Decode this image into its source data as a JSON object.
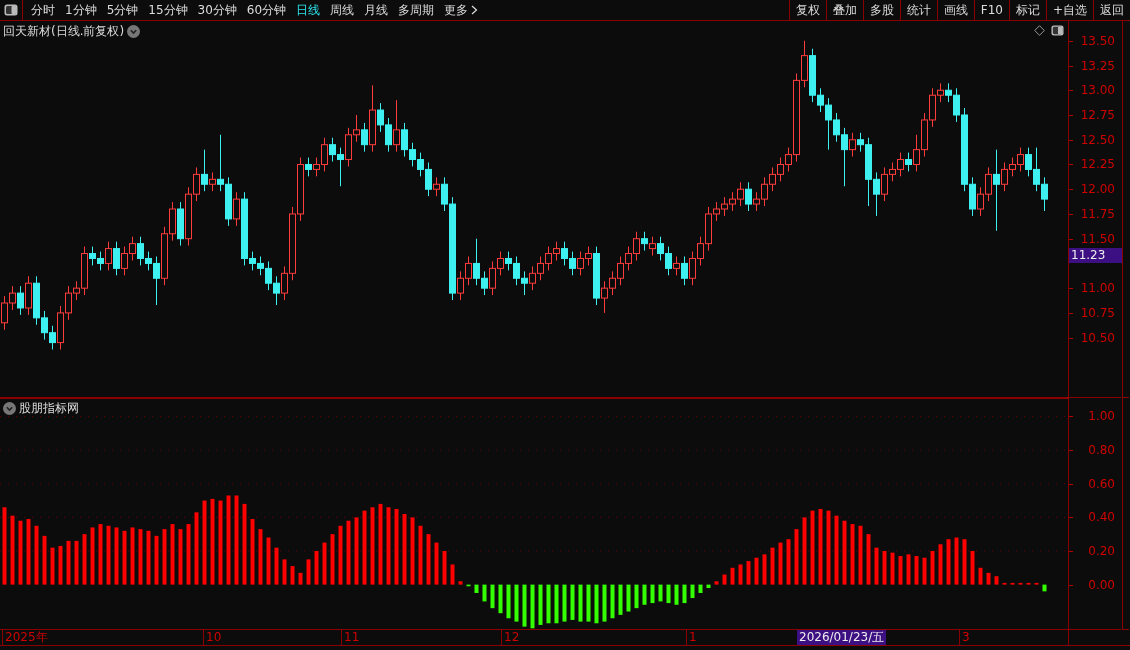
{
  "toolbar": {
    "periods": [
      {
        "label": "分时",
        "selected": false
      },
      {
        "label": "1分钟",
        "selected": false
      },
      {
        "label": "5分钟",
        "selected": false
      },
      {
        "label": "15分钟",
        "selected": false
      },
      {
        "label": "30分钟",
        "selected": false
      },
      {
        "label": "60分钟",
        "selected": false
      },
      {
        "label": "日线",
        "selected": true
      },
      {
        "label": "周线",
        "selected": false
      },
      {
        "label": "月线",
        "selected": false
      },
      {
        "label": "多周期",
        "selected": false
      }
    ],
    "more": "更多",
    "actions": [
      "复权",
      "叠加",
      "多股",
      "统计",
      "画线",
      "F10",
      "标记",
      "+自选",
      "返回"
    ]
  },
  "main_chart": {
    "title": "回天新材(日线.前复权)",
    "last_price": "11.23",
    "chart_data": {
      "type": "candlestick",
      "ylim": [
        9.89,
        13.7
      ],
      "yticks": [
        {
          "value": 13.5,
          "label": "13.50"
        },
        {
          "value": 13.25,
          "label": "13.25"
        },
        {
          "value": 13,
          "label": "13.00"
        },
        {
          "value": 12.75,
          "label": "12.75"
        },
        {
          "value": 12.5,
          "label": "12.50"
        },
        {
          "value": 12.25,
          "label": "12.25"
        },
        {
          "value": 12,
          "label": "12.00"
        },
        {
          "value": 11.75,
          "label": "11.75"
        },
        {
          "value": 11.5,
          "label": "11.50"
        },
        {
          "value": 11,
          "label": "11.00"
        },
        {
          "value": 10.75,
          "label": "10.75"
        },
        {
          "value": 10.5,
          "label": "10.50"
        }
      ],
      "ohlc": [
        [
          10.65,
          10.92,
          10.58,
          10.85
        ],
        [
          10.85,
          11.02,
          10.78,
          10.95
        ],
        [
          10.95,
          11.02,
          10.73,
          10.8
        ],
        [
          10.8,
          11.12,
          10.73,
          11.05
        ],
        [
          11.05,
          11.12,
          10.63,
          10.7
        ],
        [
          10.7,
          10.77,
          10.48,
          10.55
        ],
        [
          10.55,
          10.62,
          10.38,
          10.45
        ],
        [
          10.45,
          10.82,
          10.38,
          10.75
        ],
        [
          10.75,
          11.02,
          10.68,
          10.95
        ],
        [
          10.95,
          11.07,
          10.88,
          11.0
        ],
        [
          11.0,
          11.42,
          10.93,
          11.35
        ],
        [
          11.35,
          11.42,
          11.23,
          11.3
        ],
        [
          11.3,
          11.37,
          11.18,
          11.25
        ],
        [
          11.25,
          11.47,
          11.18,
          11.4
        ],
        [
          11.4,
          11.47,
          11.13,
          11.2
        ],
        [
          11.2,
          11.42,
          11.13,
          11.35
        ],
        [
          11.35,
          11.52,
          11.28,
          11.45
        ],
        [
          11.45,
          11.52,
          11.23,
          11.3
        ],
        [
          11.3,
          11.37,
          11.18,
          11.25
        ],
        [
          11.25,
          11.32,
          10.83,
          11.1
        ],
        [
          11.1,
          11.62,
          11.03,
          11.55
        ],
        [
          11.55,
          11.87,
          11.48,
          11.8
        ],
        [
          11.8,
          11.87,
          11.43,
          11.5
        ],
        [
          11.5,
          12.02,
          11.43,
          11.95
        ],
        [
          11.95,
          12.22,
          11.88,
          12.15
        ],
        [
          12.15,
          12.4,
          11.98,
          12.05
        ],
        [
          12.05,
          12.17,
          11.98,
          12.1
        ],
        [
          12.1,
          12.55,
          11.98,
          12.05
        ],
        [
          12.05,
          12.12,
          11.63,
          11.7
        ],
        [
          11.7,
          11.97,
          11.63,
          11.9
        ],
        [
          11.9,
          11.97,
          11.23,
          11.3
        ],
        [
          11.3,
          11.37,
          11.18,
          11.25
        ],
        [
          11.25,
          11.32,
          11.13,
          11.2
        ],
        [
          11.2,
          11.27,
          10.98,
          11.05
        ],
        [
          11.05,
          11.12,
          10.83,
          10.95
        ],
        [
          10.95,
          11.22,
          10.88,
          11.15
        ],
        [
          11.15,
          11.82,
          11.08,
          11.75
        ],
        [
          11.75,
          12.32,
          11.68,
          12.25
        ],
        [
          12.25,
          12.32,
          12.13,
          12.2
        ],
        [
          12.2,
          12.32,
          12.13,
          12.25
        ],
        [
          12.25,
          12.52,
          12.18,
          12.45
        ],
        [
          12.45,
          12.52,
          12.28,
          12.35
        ],
        [
          12.35,
          12.42,
          12.03,
          12.3
        ],
        [
          12.3,
          12.62,
          12.23,
          12.55
        ],
        [
          12.55,
          12.75,
          12.48,
          12.6
        ],
        [
          12.6,
          12.67,
          12.38,
          12.45
        ],
        [
          12.45,
          13.05,
          12.38,
          12.8
        ],
        [
          12.8,
          12.87,
          12.58,
          12.65
        ],
        [
          12.65,
          12.72,
          12.38,
          12.45
        ],
        [
          12.45,
          12.9,
          12.38,
          12.6
        ],
        [
          12.6,
          12.67,
          12.33,
          12.4
        ],
        [
          12.4,
          12.47,
          12.23,
          12.3
        ],
        [
          12.3,
          12.37,
          12.13,
          12.2
        ],
        [
          12.2,
          12.27,
          11.93,
          12.0
        ],
        [
          12.0,
          12.12,
          11.93,
          12.05
        ],
        [
          12.05,
          12.12,
          11.78,
          11.85
        ],
        [
          11.85,
          11.92,
          10.88,
          10.95
        ],
        [
          10.95,
          11.17,
          10.88,
          11.1
        ],
        [
          11.1,
          11.32,
          11.03,
          11.25
        ],
        [
          11.25,
          11.5,
          11.03,
          11.1
        ],
        [
          11.1,
          11.17,
          10.93,
          11.0
        ],
        [
          11.0,
          11.27,
          10.93,
          11.2
        ],
        [
          11.2,
          11.37,
          11.13,
          11.3
        ],
        [
          11.3,
          11.37,
          11.18,
          11.25
        ],
        [
          11.25,
          11.32,
          11.03,
          11.1
        ],
        [
          11.1,
          11.17,
          10.93,
          11.05
        ],
        [
          11.05,
          11.22,
          10.98,
          11.15
        ],
        [
          11.15,
          11.32,
          11.08,
          11.25
        ],
        [
          11.25,
          11.42,
          11.18,
          11.35
        ],
        [
          11.35,
          11.47,
          11.28,
          11.4
        ],
        [
          11.4,
          11.47,
          11.23,
          11.3
        ],
        [
          11.3,
          11.37,
          11.13,
          11.2
        ],
        [
          11.2,
          11.37,
          11.13,
          11.3
        ],
        [
          11.3,
          11.42,
          11.23,
          11.35
        ],
        [
          11.35,
          11.42,
          10.83,
          10.9
        ],
        [
          10.9,
          11.07,
          10.75,
          11.0
        ],
        [
          11.0,
          11.17,
          10.93,
          11.1
        ],
        [
          11.1,
          11.32,
          11.03,
          11.25
        ],
        [
          11.25,
          11.42,
          11.18,
          11.35
        ],
        [
          11.35,
          11.57,
          11.28,
          11.5
        ],
        [
          11.5,
          11.57,
          11.38,
          11.45
        ],
        [
          11.4,
          11.52,
          11.33,
          11.45
        ],
        [
          11.45,
          11.52,
          11.28,
          11.35
        ],
        [
          11.35,
          11.42,
          11.13,
          11.2
        ],
        [
          11.2,
          11.32,
          11.13,
          11.25
        ],
        [
          11.25,
          11.32,
          11.03,
          11.1
        ],
        [
          11.1,
          11.37,
          11.03,
          11.3
        ],
        [
          11.3,
          11.52,
          11.23,
          11.45
        ],
        [
          11.45,
          11.82,
          11.38,
          11.75
        ],
        [
          11.75,
          11.87,
          11.68,
          11.8
        ],
        [
          11.8,
          11.92,
          11.73,
          11.85
        ],
        [
          11.85,
          11.97,
          11.78,
          11.9
        ],
        [
          11.9,
          12.07,
          11.83,
          12.0
        ],
        [
          12.0,
          12.07,
          11.78,
          11.85
        ],
        [
          11.85,
          11.97,
          11.78,
          11.9
        ],
        [
          11.9,
          12.12,
          11.83,
          12.05
        ],
        [
          12.05,
          12.22,
          11.98,
          12.15
        ],
        [
          12.15,
          12.32,
          12.08,
          12.25
        ],
        [
          12.25,
          12.42,
          12.18,
          12.35
        ],
        [
          12.35,
          13.17,
          12.28,
          13.1
        ],
        [
          13.1,
          13.5,
          13.03,
          13.35
        ],
        [
          13.35,
          13.42,
          12.88,
          12.95
        ],
        [
          12.95,
          13.02,
          12.78,
          12.85
        ],
        [
          12.85,
          12.92,
          12.4,
          12.7
        ],
        [
          12.7,
          12.77,
          12.48,
          12.55
        ],
        [
          12.55,
          12.62,
          12.03,
          12.4
        ],
        [
          12.4,
          12.57,
          12.33,
          12.5
        ],
        [
          12.5,
          12.57,
          12.38,
          12.45
        ],
        [
          12.45,
          12.52,
          11.83,
          12.1
        ],
        [
          12.1,
          12.17,
          11.73,
          11.95
        ],
        [
          11.95,
          12.22,
          11.88,
          12.15
        ],
        [
          12.15,
          12.27,
          12.08,
          12.2
        ],
        [
          12.2,
          12.37,
          12.13,
          12.3
        ],
        [
          12.3,
          12.37,
          12.18,
          12.25
        ],
        [
          12.25,
          12.55,
          12.18,
          12.4
        ],
        [
          12.4,
          12.77,
          12.33,
          12.7
        ],
        [
          12.7,
          13.02,
          12.63,
          12.95
        ],
        [
          12.95,
          13.07,
          12.88,
          13.0
        ],
        [
          13.0,
          13.07,
          12.88,
          12.95
        ],
        [
          12.95,
          13.02,
          12.68,
          12.75
        ],
        [
          12.75,
          12.82,
          11.98,
          12.05
        ],
        [
          12.05,
          12.12,
          11.73,
          11.8
        ],
        [
          11.8,
          12.02,
          11.73,
          11.95
        ],
        [
          11.95,
          12.22,
          11.88,
          12.15
        ],
        [
          12.15,
          12.4,
          11.58,
          12.05
        ],
        [
          12.05,
          12.27,
          11.98,
          12.2
        ],
        [
          12.2,
          12.32,
          12.13,
          12.25
        ],
        [
          12.25,
          12.42,
          12.18,
          12.35
        ],
        [
          12.35,
          12.42,
          12.13,
          12.2
        ],
        [
          12.2,
          12.42,
          11.98,
          12.05
        ],
        [
          12.05,
          12.12,
          11.78,
          11.9
        ]
      ]
    }
  },
  "indicator": {
    "title": "股朋指标网",
    "chart_data": {
      "type": "bar",
      "ylim": [
        -0.27,
        1.11
      ],
      "grid": true,
      "yticks": [
        {
          "value": 0,
          "label": "0.00"
        },
        {
          "value": 0.2,
          "label": "0.20"
        },
        {
          "value": 0.4,
          "label": "0.40"
        },
        {
          "value": 0.6,
          "label": "0.60"
        },
        {
          "value": 0.8,
          "label": "0.80"
        },
        {
          "value": 1,
          "label": "1.00"
        }
      ],
      "series": [
        {
          "color": "#ff0000",
          "values": [
            0.46,
            0.41,
            0.38,
            0.39,
            0.35,
            0.29,
            0.22,
            0.23,
            0.26,
            0.26,
            0.3,
            0.34,
            0.36,
            0.35,
            0.34,
            0.32,
            0.34,
            0.33,
            0.32,
            0.29,
            0.33,
            0.36,
            0.33,
            0.36,
            0.43,
            0.5,
            0.51,
            0.5,
            0.53,
            0.53,
            0.48,
            0.39,
            0.33,
            0.28,
            0.22,
            0.15,
            0.11,
            0.07,
            0.15,
            0.2,
            0.25,
            0.3,
            0.35,
            0.38,
            0.4,
            0.44,
            0.46,
            0.48,
            0.46,
            0.45,
            0.42,
            0.4,
            0.35,
            0.3,
            0.25,
            0.2,
            0.12,
            0.02,
            null,
            null,
            null,
            null,
            null,
            null,
            null,
            null,
            null,
            null,
            null,
            null,
            null,
            null,
            null,
            null,
            null,
            null,
            null,
            null,
            null,
            null,
            null,
            null,
            null,
            null,
            null,
            null,
            null,
            null,
            null,
            0.02,
            0.06,
            0.1,
            0.12,
            0.14,
            0.16,
            0.18,
            0.22,
            0.25,
            0.27,
            0.33,
            0.4,
            0.44,
            0.45,
            0.44,
            0.41,
            0.38,
            0.36,
            0.35,
            0.3,
            0.22,
            0.2,
            0.19,
            0.17,
            0.18,
            0.17,
            0.16,
            0.2,
            0.24,
            0.27,
            0.28,
            0.27,
            0.2,
            0.1,
            0.07,
            0.05,
            0.01,
            0.01,
            0.01,
            0.01,
            0.01,
            null
          ]
        },
        {
          "color": "#33ff00",
          "values": [
            null,
            null,
            null,
            null,
            null,
            null,
            null,
            null,
            null,
            null,
            null,
            null,
            null,
            null,
            null,
            null,
            null,
            null,
            null,
            null,
            null,
            null,
            null,
            null,
            null,
            null,
            null,
            null,
            null,
            null,
            null,
            null,
            null,
            null,
            null,
            null,
            null,
            null,
            null,
            null,
            null,
            null,
            null,
            null,
            null,
            null,
            null,
            null,
            null,
            null,
            null,
            null,
            null,
            null,
            null,
            null,
            null,
            null,
            -0.01,
            -0.05,
            -0.1,
            -0.14,
            -0.17,
            -0.2,
            -0.22,
            -0.25,
            -0.26,
            -0.24,
            -0.23,
            -0.23,
            -0.22,
            -0.21,
            -0.22,
            -0.22,
            -0.23,
            -0.22,
            -0.2,
            -0.18,
            -0.16,
            -0.14,
            -0.12,
            -0.11,
            -0.1,
            -0.11,
            -0.12,
            -0.11,
            -0.08,
            -0.05,
            -0.02,
            null,
            null,
            null,
            null,
            null,
            null,
            null,
            null,
            null,
            null,
            null,
            null,
            null,
            null,
            null,
            null,
            null,
            null,
            null,
            null,
            null,
            null,
            null,
            null,
            null,
            null,
            null,
            null,
            null,
            null,
            null,
            null,
            null,
            null,
            null,
            null,
            null,
            null,
            null,
            null,
            null,
            -0.04
          ]
        }
      ]
    }
  },
  "time_axis": [
    {
      "text": "2025年",
      "kind": "label"
    },
    {
      "text": "10",
      "kind": "label"
    },
    {
      "text": "11",
      "kind": "label"
    },
    {
      "text": "12",
      "kind": "label"
    },
    {
      "text": "1",
      "kind": "label"
    },
    {
      "text": "2026/01/23/五",
      "kind": "cursor"
    },
    {
      "text": "3",
      "kind": "label"
    }
  ]
}
